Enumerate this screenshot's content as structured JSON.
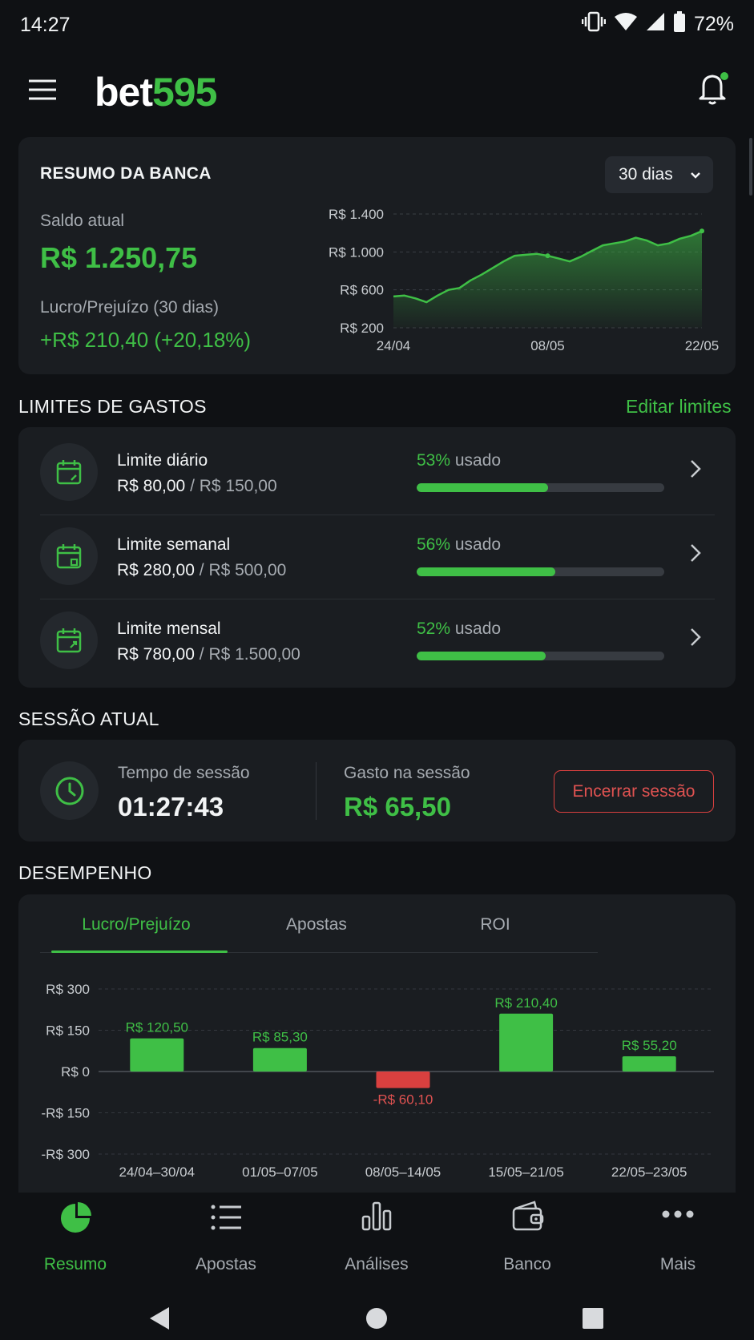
{
  "status_bar": {
    "time": "14:27",
    "battery": "72%"
  },
  "app": {
    "logo_part1": "bet",
    "logo_part2": "595"
  },
  "summary": {
    "title": "RESUMO DA BANCA",
    "period_select": "30 dias",
    "balance_label": "Saldo atual",
    "balance_value": "R$ 1.250,75",
    "pnl_label": "Lucro/Prejuízo (30 dias)",
    "pnl_value": "+R$ 210,40 (+20,18%)"
  },
  "limits": {
    "title": "LIMITES DE GASTOS",
    "edit_link": "Editar limites",
    "used_suffix": "usado",
    "items": [
      {
        "title": "Limite diário",
        "used": "R$ 80,00",
        "sep": " / ",
        "total": "R$ 150,00",
        "percent_label": "53%",
        "fraction": 0.53
      },
      {
        "title": "Limite semanal",
        "used": "R$ 280,00",
        "sep": " / ",
        "total": "R$ 500,00",
        "percent_label": "56%",
        "fraction": 0.56
      },
      {
        "title": "Limite mensal",
        "used": "R$ 780,00",
        "sep": " / ",
        "total": "R$ 1.500,00",
        "percent_label": "52%",
        "fraction": 0.52
      }
    ]
  },
  "session": {
    "title": "SESSÃO ATUAL",
    "time_label": "Tempo de sessão",
    "time_value": "01:27:43",
    "spent_label": "Gasto na sessão",
    "spent_value": "R$ 65,50",
    "end_button": "Encerrar sessão"
  },
  "performance": {
    "title": "DESEMPENHO",
    "tabs": [
      "Lucro/Prejuízo",
      "Apostas",
      "ROI"
    ],
    "active_tab": 0
  },
  "bottom_nav": [
    {
      "label": "Resumo",
      "icon": "pie-chart-icon",
      "active": true
    },
    {
      "label": "Apostas",
      "icon": "list-icon",
      "active": false
    },
    {
      "label": "Análises",
      "icon": "bar-chart-icon",
      "active": false
    },
    {
      "label": "Banco",
      "icon": "wallet-icon",
      "active": false
    },
    {
      "label": "Mais",
      "icon": "more-icon",
      "active": false
    }
  ],
  "colors": {
    "accent": "#3fbf46",
    "negative": "#d9403f",
    "background": "#0f1114",
    "card": "#1a1d21"
  },
  "chart_data": [
    {
      "type": "area",
      "title": "",
      "ylim": [
        200,
        1400
      ],
      "yticks": [
        200,
        600,
        1000,
        1400
      ],
      "ytick_labels": [
        "R$ 200",
        "R$ 600",
        "R$ 1.000",
        "R$ 1.400"
      ],
      "xtick_labels": [
        "24/04",
        "08/05",
        "22/05"
      ],
      "x": [
        "24/04",
        "25/04",
        "26/04",
        "27/04",
        "28/04",
        "29/04",
        "30/04",
        "01/05",
        "02/05",
        "03/05",
        "04/05",
        "05/05",
        "06/05",
        "07/05",
        "08/05",
        "09/05",
        "10/05",
        "11/05",
        "12/05",
        "13/05",
        "14/05",
        "15/05",
        "16/05",
        "17/05",
        "18/05",
        "19/05",
        "20/05",
        "21/05",
        "22/05"
      ],
      "values": [
        530,
        540,
        510,
        470,
        540,
        600,
        620,
        700,
        760,
        830,
        900,
        960,
        970,
        980,
        960,
        930,
        900,
        950,
        1010,
        1070,
        1090,
        1110,
        1150,
        1120,
        1070,
        1090,
        1140,
        1170,
        1220
      ],
      "grid": true
    },
    {
      "type": "bar",
      "title": "",
      "categories": [
        "24/04–30/04",
        "01/05–07/05",
        "08/05–14/05",
        "15/05–21/05",
        "22/05–23/05"
      ],
      "values": [
        120.5,
        85.3,
        -60.1,
        210.4,
        55.2
      ],
      "value_labels": [
        "R$ 120,50",
        "R$ 85,30",
        "-R$ 60,10",
        "R$ 210,40",
        "R$ 55,20"
      ],
      "ylim": [
        -300,
        300
      ],
      "yticks": [
        300,
        150,
        0,
        -150,
        -300
      ],
      "ytick_labels": [
        "R$ 300",
        "R$ 150",
        "R$ 0",
        "-R$ 150",
        "-R$ 300"
      ],
      "grid": true
    }
  ]
}
